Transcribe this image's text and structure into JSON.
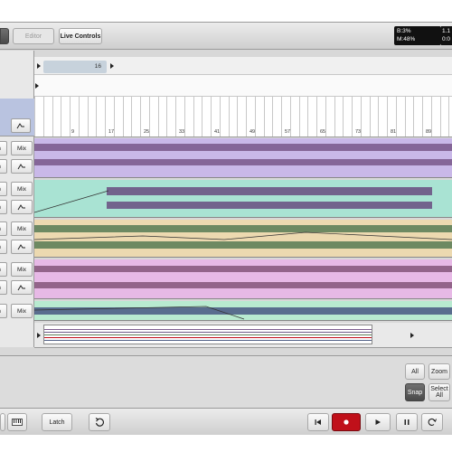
{
  "toolbar": {
    "editor_label": "Editor",
    "live_controls_label": "Live Controls"
  },
  "status": {
    "line1": "B:3%",
    "line2": "M:48%",
    "right1": "1.1",
    "right2": "0:0"
  },
  "timeline": {
    "loop_value": "16",
    "ruler_labels": [
      "9",
      "17",
      "25",
      "33",
      "41",
      "49",
      "57",
      "65",
      "73",
      "81",
      "89"
    ]
  },
  "tracks": [
    {
      "row1_button": "Mix",
      "row2_button": ""
    },
    {
      "row1_button": "Mix",
      "row2_button": ""
    },
    {
      "row1_button": "Mix",
      "row2_button": ""
    },
    {
      "row1_button": "Mix",
      "row2_button": ""
    },
    {
      "row1_button": "Mix"
    }
  ],
  "track_left_fragment": "n",
  "colors": {
    "purple_bg": "#c9b8e8",
    "teal_bg": "#a9e3d3",
    "tan_bg": "#ecd9b0",
    "pink_bg": "#e7b9e6",
    "mint_bg": "#b8ead0",
    "wave_purple": "#7d5d8f",
    "wave_teal": "#6f5c88",
    "wave_green": "#5f7f5a",
    "wave_pink": "#8a5b7f",
    "wave_blue": "#4f5f86",
    "record_red": "#c0101a"
  },
  "lower_panel": {
    "all_label": "All",
    "zoom_label": "Zoom",
    "snap_label": "Snap",
    "select_all_label": "Select\nAll"
  },
  "bottom": {
    "latch_label": "Latch"
  }
}
